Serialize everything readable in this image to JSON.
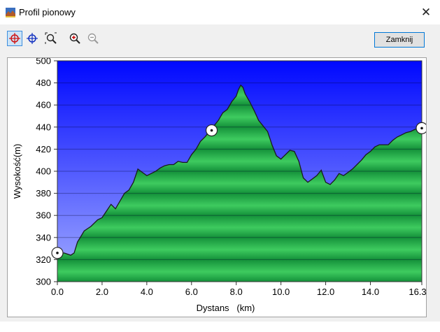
{
  "window": {
    "title": "Profil pionowy",
    "close_glyph": "✕"
  },
  "toolbar": {
    "buttons": [
      {
        "icon": "crosshair-red-icon"
      },
      {
        "icon": "crosshair-blue-icon"
      },
      {
        "icon": "zoom-area-icon"
      },
      {
        "icon": "zoom-in-icon"
      },
      {
        "icon": "zoom-out-icon"
      }
    ],
    "close_label": "Zamknij"
  },
  "colors": {
    "sky_top": "#0008ff",
    "sky_bottom": "#9aa6ff",
    "terrain_light": "#3ecb5f",
    "terrain_dark": "#138f35",
    "marker": "#ffffff"
  },
  "chart_data": {
    "type": "area",
    "title": "",
    "xlabel": "Dystans   (km)",
    "ylabel": "Wysokość(m)",
    "xlim": [
      0,
      16.3
    ],
    "ylim": [
      300,
      500
    ],
    "x_ticks": [
      "0.0",
      "2.0",
      "4.0",
      "6.0",
      "8.0",
      "10.0",
      "12.0",
      "14.0",
      "16.3"
    ],
    "x_tick_values": [
      0,
      2,
      4,
      6,
      8,
      10,
      12,
      14,
      16.3
    ],
    "y_ticks": [
      "300",
      "320",
      "340",
      "360",
      "380",
      "400",
      "420",
      "440",
      "460",
      "480",
      "500"
    ],
    "y_tick_values": [
      300,
      320,
      340,
      360,
      380,
      400,
      420,
      440,
      460,
      480,
      500
    ],
    "grid": true,
    "series": [
      {
        "x": [
          0,
          0.3,
          0.6,
          0.75,
          0.9,
          1.2,
          1.5,
          1.8,
          2.0,
          2.2,
          2.4,
          2.6,
          2.8,
          3.0,
          3.2,
          3.4,
          3.5,
          3.6,
          3.8,
          4.0,
          4.2,
          4.4,
          4.6,
          4.8,
          5.0,
          5.2,
          5.4,
          5.6,
          5.8,
          6.0,
          6.2,
          6.4,
          6.6,
          6.8,
          7.0,
          7.2,
          7.4,
          7.6,
          7.8,
          8.0,
          8.1,
          8.2,
          8.3,
          8.4,
          8.6,
          8.8,
          9.0,
          9.2,
          9.4,
          9.6,
          9.8,
          10.0,
          10.2,
          10.4,
          10.6,
          10.8,
          11.0,
          11.2,
          11.4,
          11.6,
          11.8,
          12.0,
          12.2,
          12.4,
          12.6,
          12.8,
          13.0,
          13.2,
          13.4,
          13.6,
          13.8,
          14.0,
          14.2,
          14.4,
          14.6,
          14.8,
          15.0,
          15.2,
          15.4,
          15.6,
          15.8,
          16.0,
          16.3
        ],
        "y": [
          325,
          326,
          324,
          326,
          336,
          346,
          350,
          356,
          358,
          364,
          370,
          366,
          373,
          380,
          383,
          390,
          396,
          402,
          399,
          396,
          398,
          400,
          403,
          405,
          406,
          406,
          409,
          408,
          408,
          415,
          420,
          427,
          431,
          436,
          441,
          446,
          453,
          456,
          463,
          468,
          474,
          478,
          476,
          470,
          463,
          455,
          446,
          441,
          436,
          424,
          414,
          411,
          415,
          419,
          418,
          409,
          394,
          390,
          393,
          396,
          401,
          390,
          388,
          392,
          398,
          396,
          399,
          402,
          406,
          410,
          415,
          418,
          422,
          424,
          424,
          424,
          428,
          431,
          433,
          435,
          436,
          438,
          439
        ]
      }
    ],
    "markers": [
      {
        "x": 0.0,
        "y": 326
      },
      {
        "x": 6.9,
        "y": 437
      },
      {
        "x": 16.3,
        "y": 439
      }
    ]
  }
}
